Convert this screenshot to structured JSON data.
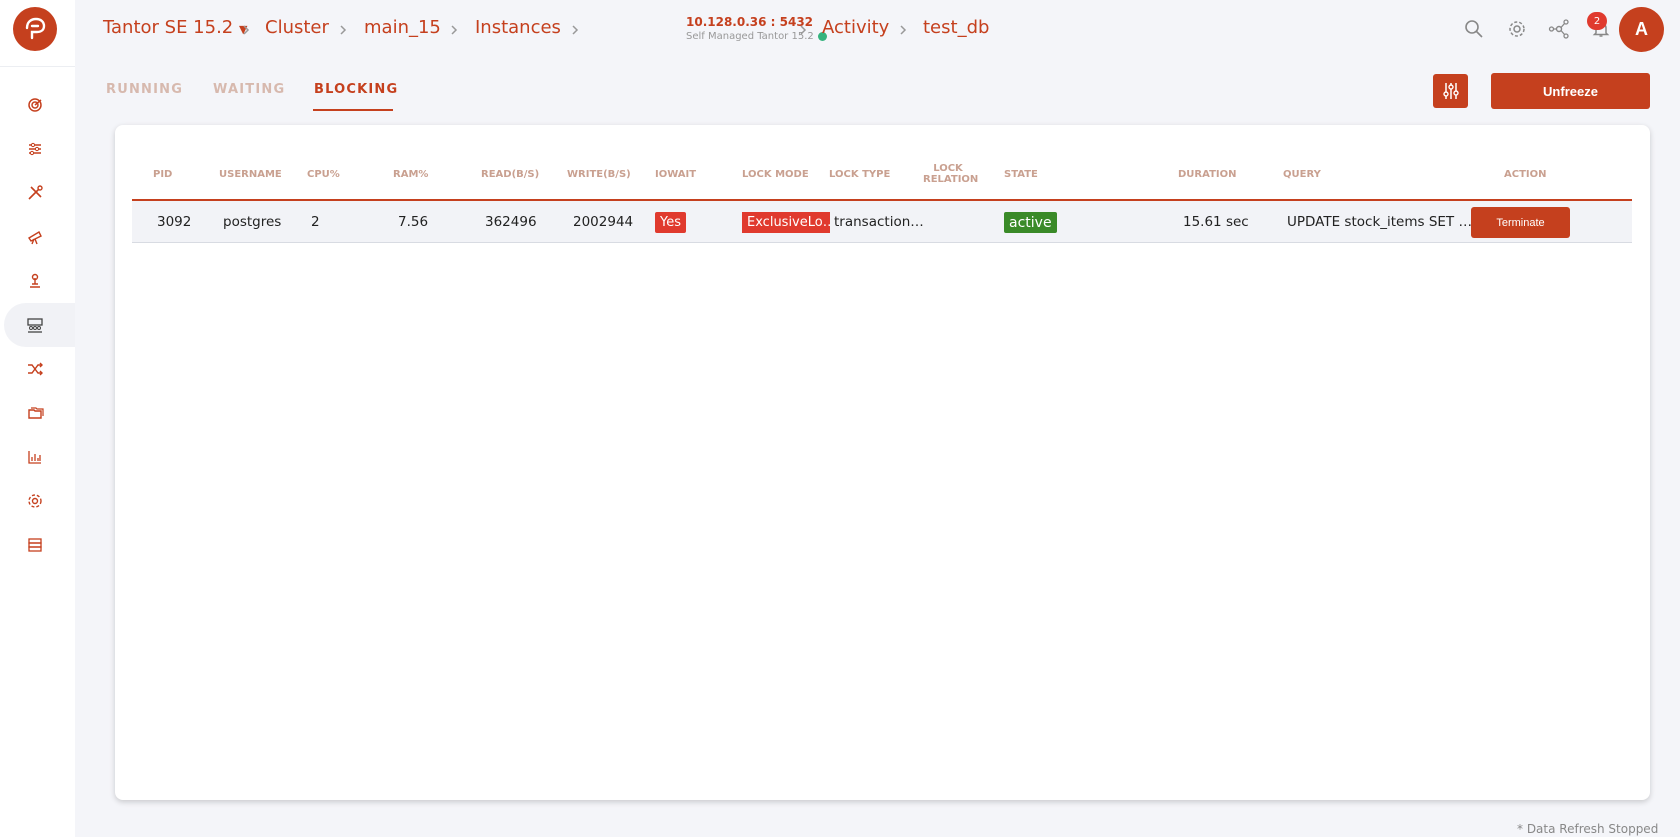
{
  "colors": {
    "accent": "#c5401e",
    "danger": "#e03a2e",
    "success": "#3a8a28"
  },
  "breadcrumb": {
    "product": "Tantor SE 15.2",
    "cluster": "Cluster",
    "cluster_name": "main_15",
    "instances": "Instances",
    "server_address": "10.128.0.36 : 5432",
    "server_subtitle": "Self Managed Tantor 15.2",
    "activity": "Activity",
    "database": "test_db"
  },
  "topbar": {
    "notification_count": "2",
    "avatar_initial": "A",
    "icons": [
      "search-icon",
      "settings-icon",
      "topology-icon",
      "bell-icon"
    ]
  },
  "sidebar": {
    "items": [
      "dashboard-icon",
      "tuning-icon",
      "tools-icon",
      "telescope-icon",
      "maintenance-icon",
      "activity-icon",
      "replication-icon",
      "databases-icon",
      "charts-icon",
      "settings-icon",
      "storage-icon"
    ],
    "active": "activity-icon"
  },
  "tabs": [
    {
      "label": "RUNNING",
      "active": false
    },
    {
      "label": "WAITING",
      "active": false
    },
    {
      "label": "BLOCKING",
      "active": true
    }
  ],
  "actions": {
    "unfreeze_label": "Unfreeze"
  },
  "table": {
    "columns": [
      "PID",
      "USERNAME",
      "CPU%",
      "RAM%",
      "READ(B/S)",
      "WRITE(B/S)",
      "IOWAIT",
      "LOCK MODE",
      "LOCK TYPE",
      "LOCK RELATION",
      "STATE",
      "DURATION",
      "QUERY",
      "ACTION"
    ],
    "rows": [
      {
        "pid": "3092",
        "username": "postgres",
        "cpu": "2",
        "ram": "7.56",
        "read": "362496",
        "write": "2002944",
        "iowait": "Yes",
        "lock_mode": "ExclusiveLo…",
        "lock_type": "transaction…",
        "lock_relation": "",
        "state": "active",
        "duration": "15.61 sec",
        "query": "UPDATE stock_items SET …",
        "action": "Terminate"
      }
    ]
  },
  "footer": {
    "note": "* Data Refresh Stopped"
  }
}
